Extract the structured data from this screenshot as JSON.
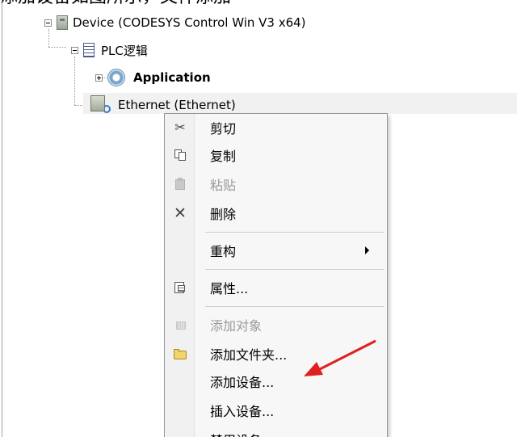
{
  "top_caption": "添加设备如图所示，文件添加",
  "tree": {
    "nodes": [
      {
        "label": "Device (CODESYS Control Win V3 x64)",
        "icon": "device-icon",
        "expanded": true
      },
      {
        "label": "PLC逻辑",
        "icon": "plc-logic-icon",
        "expanded": true
      },
      {
        "label": "Application",
        "icon": "application-gear-icon",
        "expanded": false
      },
      {
        "label": "Ethernet (Ethernet)",
        "icon": "ethernet-device-icon",
        "selected": true
      }
    ]
  },
  "context_menu": {
    "items": [
      {
        "label": "剪切",
        "icon": "scissors-icon",
        "enabled": true
      },
      {
        "label": "复制",
        "icon": "copy-icon",
        "enabled": true
      },
      {
        "label": "粘贴",
        "icon": "paste-icon",
        "enabled": false
      },
      {
        "label": "删除",
        "icon": "delete-x-icon",
        "enabled": true
      },
      {
        "label": "重构",
        "icon": "",
        "enabled": true,
        "has_submenu": true
      },
      {
        "label": "属性...",
        "icon": "properties-icon",
        "enabled": true
      },
      {
        "label": "添加对象",
        "icon": "add-object-icon",
        "enabled": false
      },
      {
        "label": "添加文件夹...",
        "icon": "folder-icon",
        "enabled": true
      },
      {
        "label": "添加设备...",
        "icon": "",
        "enabled": true
      },
      {
        "label": "插入设备...",
        "icon": "",
        "enabled": true
      },
      {
        "label": "禁用设备",
        "icon": "",
        "enabled": true
      }
    ]
  },
  "annotation": {
    "color": "#e02020",
    "points_to": "添加设备..."
  },
  "colors": {
    "menu_background": "#f7f7f7",
    "selection_row": "#f1f1f1",
    "disabled_text": "#9a9a9a"
  }
}
